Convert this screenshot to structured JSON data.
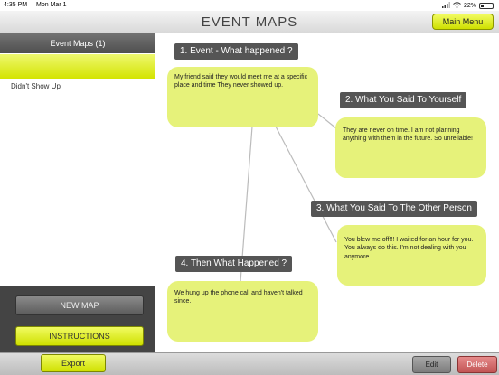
{
  "status": {
    "time": "4:35 PM",
    "date": "Mon Mar 1",
    "battery": "22%"
  },
  "header": {
    "title": "EVENT MAPS",
    "main_menu": "Main Menu"
  },
  "sidebar": {
    "heading": "Event Maps  (1)",
    "items": [
      {
        "label": "Didn't Show Up"
      }
    ],
    "new_map": "NEW MAP",
    "instructions": "INSTRUCTIONS"
  },
  "map": {
    "nodes": [
      {
        "title": "1.  Event - What happened ?",
        "text": "My friend said they would meet me at a specific place and time  They never showed up."
      },
      {
        "title": "2.  What You Said To Yourself",
        "text": "They are never on time.  I am not planning anything with them in the future.  So unreliable!"
      },
      {
        "title": "3.  What You Said To The Other Person",
        "text": "You blew me off!!! I waited for an hour for you.  You always do this.  I'm not dealing with you anymore."
      },
      {
        "title": "4.  Then What Happened ?",
        "text": "We hung up the phone call and haven't talked since."
      }
    ]
  },
  "footer": {
    "export": "Export",
    "edit": "Edit",
    "delete": "Delete"
  },
  "colors": {
    "accent": "#d9e93a",
    "bubble": "#e6f27a",
    "label_bg": "#555555",
    "delete": "#c25454"
  }
}
